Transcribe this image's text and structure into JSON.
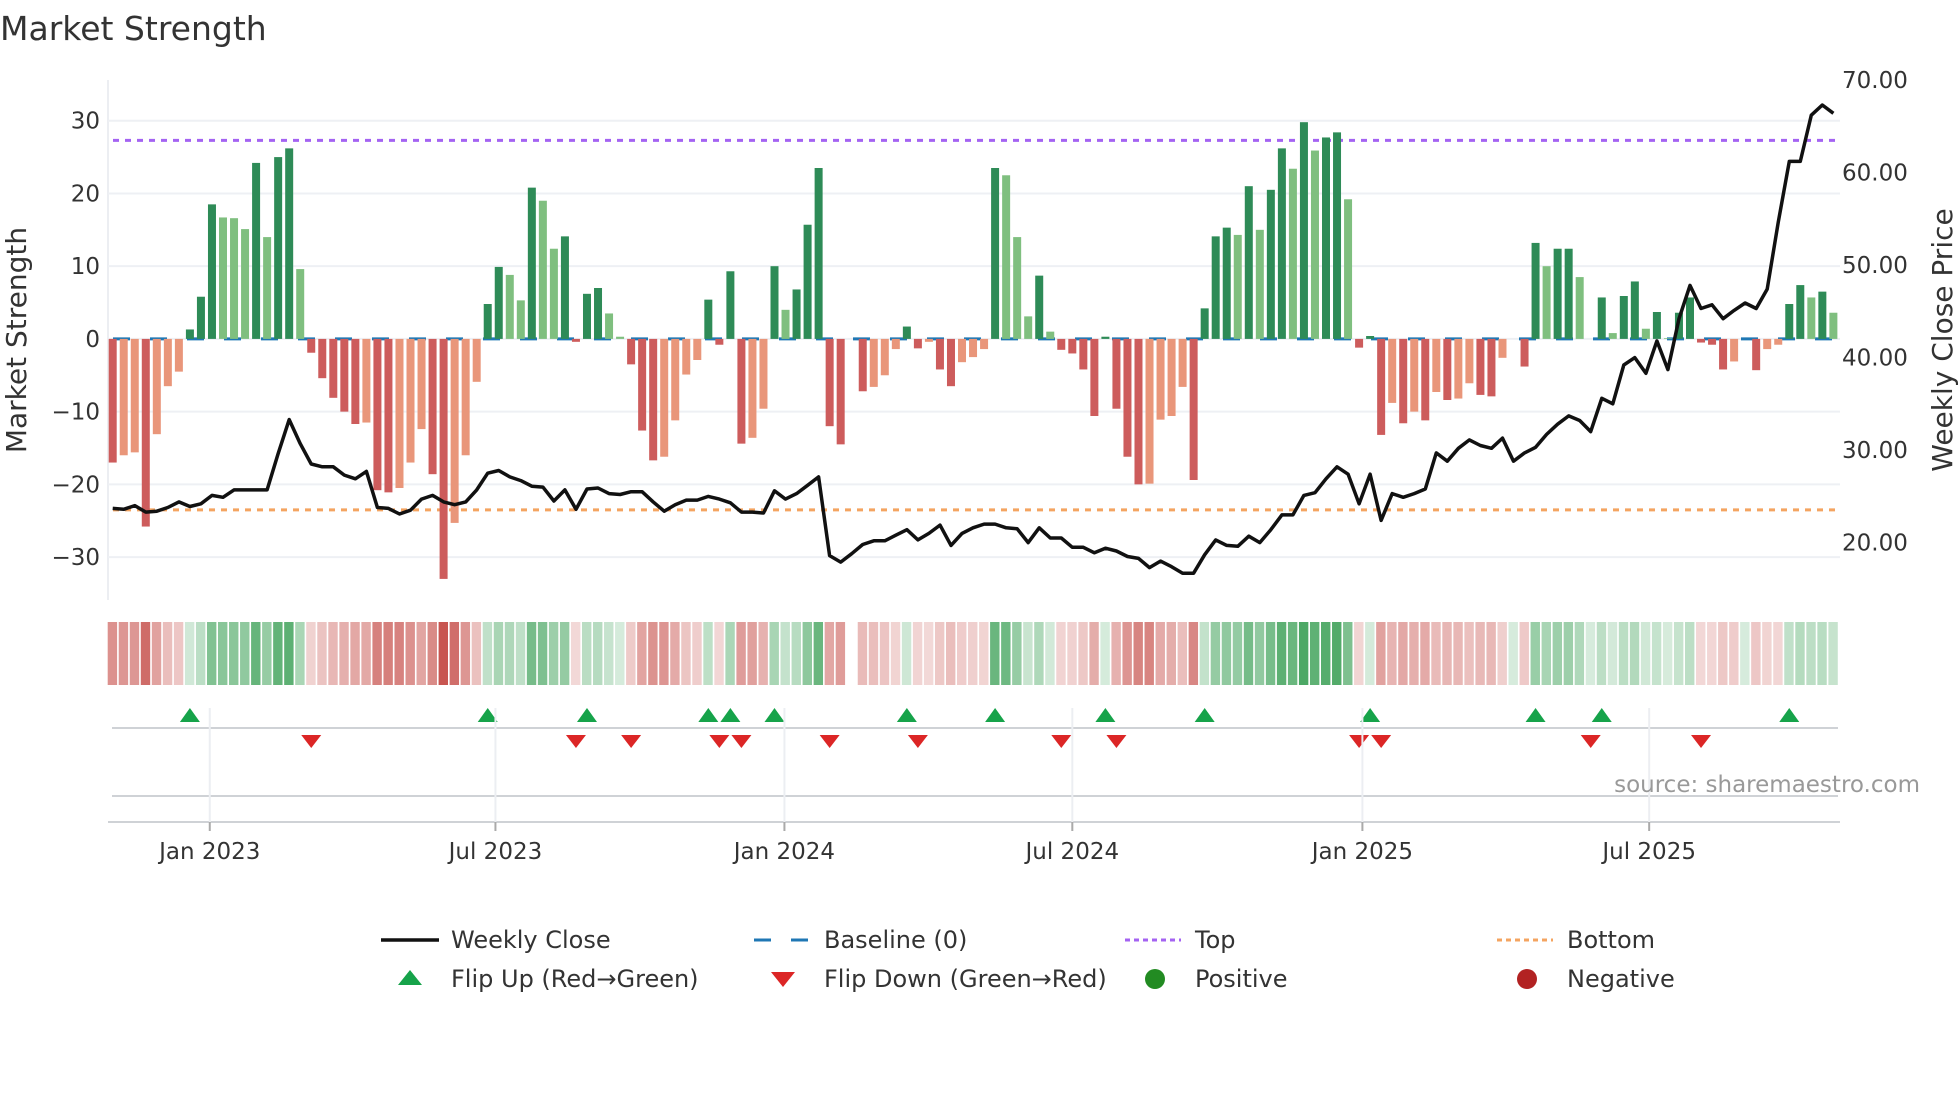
{
  "chart_data": {
    "type": "bar",
    "title": "Market Strength",
    "ylabel": "Market Strength",
    "y2label": "Weekly Close Price",
    "ylim": [
      -35.9,
      35.6
    ],
    "y2lim": [
      13.8,
      70
    ],
    "yticks": [
      30,
      20,
      10,
      0,
      -10,
      -20,
      -30
    ],
    "ytick_labels": [
      "30",
      "20",
      "10",
      "0",
      "−10",
      "−20",
      "−30"
    ],
    "y2ticks": [
      70,
      60,
      50,
      40,
      30,
      20
    ],
    "y2tick_labels": [
      "70.00",
      "60.00",
      "50.00",
      "40.00",
      "30.00",
      "20.00"
    ],
    "x_unit": "week index",
    "xticks": [
      {
        "pos": 8.8,
        "label": "Jan 2023"
      },
      {
        "pos": 34.7,
        "label": "Jul 2023"
      },
      {
        "pos": 60.9,
        "label": "Jan 2024"
      },
      {
        "pos": 87.0,
        "label": "Jul 2024"
      },
      {
        "pos": 113.3,
        "label": "Jan 2025"
      },
      {
        "pos": 139.3,
        "label": "Jul 2025"
      }
    ],
    "grid": true,
    "top_level": 27.3,
    "bottom_level": -23.5,
    "baseline": 0,
    "strength": [
      -17,
      -16,
      -15.6,
      -25.8,
      -13.1,
      -6.5,
      -4.5,
      1.3,
      5.8,
      18.5,
      16.7,
      16.6,
      15.1,
      24.2,
      14,
      25,
      26.2,
      9.6,
      -1.9,
      -5.4,
      -8.1,
      -10,
      -11.7,
      -11.5,
      -20.8,
      -21.1,
      -20.5,
      -17,
      -12.4,
      -18.6,
      -33,
      -25.3,
      -16,
      -5.9,
      4.8,
      9.9,
      8.8,
      5.3,
      20.8,
      19,
      12.4,
      14.1,
      -0.4,
      6.2,
      7,
      3.5,
      0.3,
      -3.5,
      -12.6,
      -16.7,
      -16.2,
      -11.2,
      -4.9,
      -2.9,
      5.4,
      -0.8,
      9.3,
      -14.4,
      -13.6,
      -9.6,
      10,
      4,
      6.8,
      15.7,
      23.5,
      -12,
      -14.5,
      0,
      -7.2,
      -6.6,
      -5,
      -1.4,
      1.7,
      -1.3,
      -0.4,
      -4.2,
      -6.5,
      -3.2,
      -2.5,
      -1.4,
      23.5,
      22.5,
      14,
      3.1,
      8.7,
      1,
      -1.5,
      -2,
      -4.2,
      -10.6,
      0.3,
      -9.6,
      -16.2,
      -20,
      -19.9,
      -11.1,
      -10.6,
      -6.6,
      -19.4,
      4.2,
      14.1,
      15.3,
      14.3,
      21,
      15,
      20.5,
      26.2,
      23.4,
      29.8,
      25.9,
      27.7,
      28.4,
      19.2,
      -1.2,
      0.4,
      -13.2,
      -8.8,
      -11.6,
      -10,
      -11.2,
      -7.3,
      -8.4,
      -8.2,
      -6.1,
      -7.7,
      -7.9,
      -2.6,
      0,
      -3.8,
      13.2,
      10,
      12.4,
      12.4,
      8.5,
      0,
      5.7,
      0.8,
      5.9,
      7.9,
      1.4,
      3.7,
      0.1,
      3.6,
      5.7,
      -0.5,
      -0.8,
      -4.2,
      -3.1,
      0,
      -4.3,
      -1.4,
      -0.8,
      4.8,
      7.4,
      5.7,
      6.5,
      3.6
    ],
    "weekly_close": [
      23.7,
      23.6,
      24.0,
      23.3,
      23.4,
      23.8,
      24.4,
      23.9,
      24.2,
      25.1,
      24.9,
      25.7,
      25.7,
      25.7,
      25.7,
      29.6,
      33.3,
      30.7,
      28.5,
      28.2,
      28.2,
      27.3,
      26.9,
      27.7,
      23.8,
      23.7,
      23.1,
      23.5,
      24.7,
      25.1,
      24.4,
      24.1,
      24.4,
      25.7,
      27.5,
      27.8,
      27.1,
      26.7,
      26.1,
      26.0,
      24.5,
      25.7,
      23.6,
      25.8,
      25.9,
      25.3,
      25.2,
      25.5,
      25.5,
      24.4,
      23.4,
      24.1,
      24.6,
      24.6,
      25.0,
      24.7,
      24.3,
      23.3,
      23.3,
      23.2,
      25.6,
      24.7,
      25.3,
      26.2,
      27.1,
      18.6,
      17.9,
      18.8,
      19.8,
      20.2,
      20.2,
      20.8,
      21.4,
      20.3,
      21.0,
      21.9,
      19.7,
      21.0,
      21.6,
      22.0,
      22.0,
      21.6,
      21.5,
      20.0,
      21.6,
      20.5,
      20.5,
      19.5,
      19.5,
      18.9,
      19.4,
      19.1,
      18.5,
      18.3,
      17.3,
      18.0,
      17.4,
      16.7,
      16.7,
      18.7,
      20.3,
      19.7,
      19.6,
      20.7,
      20.0,
      21.4,
      23.0,
      23.0,
      25.1,
      25.4,
      26.9,
      28.2,
      27.4,
      24.2,
      27.4,
      22.4,
      25.3,
      24.9,
      25.3,
      25.8,
      29.7,
      28.8,
      30.2,
      31.1,
      30.5,
      30.2,
      31.3,
      28.8,
      29.7,
      30.3,
      31.7,
      32.8,
      33.7,
      33.2,
      32.0,
      35.6,
      35.0,
      39.2,
      40.0,
      38.3,
      41.8,
      38.7,
      44.2,
      47.8,
      45.3,
      45.7,
      44.2,
      45.1,
      45.9,
      45.3,
      47.4,
      54.6,
      61.2,
      61.2,
      66.2,
      67.3,
      66.4
    ],
    "flip_up_weeks": [
      7,
      34,
      43,
      54,
      56,
      60,
      72,
      80,
      90,
      99,
      114,
      129,
      135,
      152
    ],
    "flip_down_weeks": [
      18,
      42,
      47,
      55,
      57,
      65,
      73,
      86,
      91,
      113,
      115,
      134,
      144
    ],
    "legend_position": "bottom",
    "legend": [
      {
        "key": "close",
        "label": "Weekly Close"
      },
      {
        "key": "baseline",
        "label": "Baseline (0)"
      },
      {
        "key": "top",
        "label": "Top"
      },
      {
        "key": "bottom",
        "label": "Bottom"
      },
      {
        "key": "flip_up",
        "label": "Flip Up (Red→Green)"
      },
      {
        "key": "flip_down",
        "label": "Flip Down (Green→Red)"
      },
      {
        "key": "positive",
        "label": "Positive"
      },
      {
        "key": "negative",
        "label": "Negative"
      }
    ],
    "source": "source: sharemaestro.com"
  },
  "colors": {
    "pos_strong": "#2e8b57",
    "pos_weak": "#7fbf7f",
    "neg_strong": "#cd5c5c",
    "neg_weak": "#e9967a",
    "close": "#111111",
    "baseline": "#1f77b4",
    "top": "#a463f2",
    "bottom": "#f4a460",
    "flip_up": "#16a34a",
    "flip_down": "#dc2626",
    "positive": "#228b22",
    "negative": "#b22222"
  }
}
